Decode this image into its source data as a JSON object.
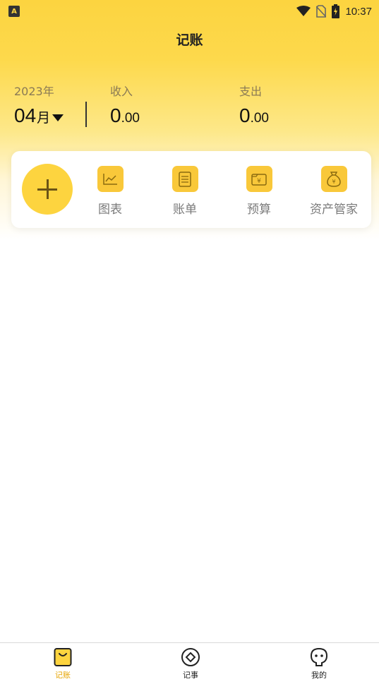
{
  "status_bar": {
    "app_badge": "A",
    "time": "10:37"
  },
  "title": "记账",
  "summary": {
    "year": "2023年",
    "month_num": "04",
    "month_unit": "月",
    "income_label": "收入",
    "income_int": "0",
    "income_dec": ".00",
    "expense_label": "支出",
    "expense_int": "0",
    "expense_dec": ".00"
  },
  "quick_actions": [
    {
      "label": "图表",
      "icon": "chart-icon"
    },
    {
      "label": "账单",
      "icon": "bill-icon"
    },
    {
      "label": "预算",
      "icon": "budget-icon"
    },
    {
      "label": "资产管家",
      "icon": "money-bag-icon"
    }
  ],
  "bottom_nav": [
    {
      "label": "记账",
      "icon": "bag-icon",
      "active": true
    },
    {
      "label": "记事",
      "icon": "diamond-circle-icon",
      "active": false
    },
    {
      "label": "我的",
      "icon": "face-icon",
      "active": false
    }
  ],
  "colors": {
    "accent": "#fdd43f",
    "icon_bg": "#f9c83a",
    "active_nav": "#e6a400"
  }
}
